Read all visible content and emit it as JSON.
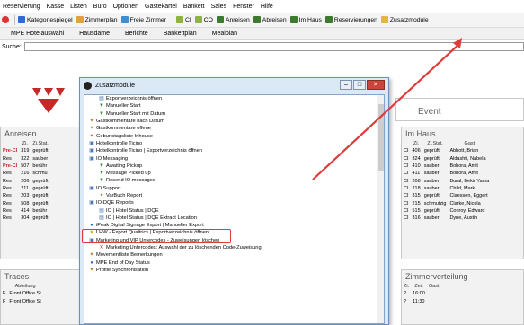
{
  "menubar": [
    "Reservierung",
    "Kasse",
    "Listen",
    "Büro",
    "Optionen",
    "Gästekartei",
    "Bankett",
    "Sales",
    "Fenster",
    "Hilfe"
  ],
  "toolbar": [
    "Kategoriespiegel",
    "Zimmerplan",
    "Freie Zimmer",
    "CI",
    "CO",
    "Anreisen",
    "Abreisen",
    "Im Haus",
    "Reservierungen",
    "Zusatzmodule"
  ],
  "nav": [
    "MPE Hotelauswahl",
    "Hausdame",
    "Berichte",
    "Bankettplan",
    "Mealplan"
  ],
  "search": {
    "label": "Suche:",
    "value": ""
  },
  "anreisen": {
    "title": "Anreisen",
    "headers": [
      "",
      "Zi.",
      "Zi.Stat."
    ],
    "rows": [
      [
        "Pre-CI",
        "319",
        "geprüft"
      ],
      [
        "Res",
        "322",
        "sauber"
      ],
      [
        "Pre-CI",
        "507",
        "berühr"
      ],
      [
        "Res",
        "216",
        "schmu"
      ],
      [
        "Res",
        "206",
        "geprüft"
      ],
      [
        "Res",
        "211",
        "geprüft"
      ],
      [
        "Res",
        "203",
        "geprüft"
      ],
      [
        "Res",
        "508",
        "geprüft"
      ],
      [
        "Res",
        "414",
        "berühr"
      ],
      [
        "Res",
        "304",
        "geprüft"
      ]
    ]
  },
  "imhaus": {
    "title": "Im Haus",
    "headers": [
      "",
      "Zi.",
      "Zi.Stat.",
      "Gast"
    ],
    "rows": [
      [
        "CI",
        "406",
        "geprüft",
        "Abbott, Brian"
      ],
      [
        "CI",
        "324",
        "geprüft",
        "Aldashti, Nabela"
      ],
      [
        "CI",
        "410",
        "sauber",
        "Bohora, Amit"
      ],
      [
        "CI",
        "411",
        "sauber",
        "Bohora, Amit"
      ],
      [
        "CI",
        "208",
        "sauber",
        "Bural, Bekir Yama"
      ],
      [
        "CI",
        "218",
        "sauber",
        "Child, Mark"
      ],
      [
        "CI",
        "315",
        "geprüft",
        "Claessen, Eggert"
      ],
      [
        "CI",
        "215",
        "schmutzig",
        "Clarke, Nicola"
      ],
      [
        "CI",
        "515",
        "geprüft",
        "Conroy, Edward"
      ],
      [
        "CI",
        "316",
        "sauber",
        "Dyne, Austin"
      ]
    ]
  },
  "event": {
    "title": "Event"
  },
  "traces": {
    "title": "Traces",
    "headers": [
      "",
      "Abteilung"
    ],
    "rows": [
      [
        "F",
        "Front Office St"
      ],
      [
        "F",
        "Front Office St"
      ]
    ]
  },
  "zimmerverteilung": {
    "title": "Zimmerverteilung",
    "headers": [
      "Zi.",
      "Zeit",
      "Gast"
    ],
    "rows": [
      [
        "?",
        "16:00"
      ],
      [
        "?",
        "11:30"
      ]
    ]
  },
  "dialog": {
    "title": "Zusatzmodule",
    "items": [
      {
        "indent": 2,
        "icon": "doc-icon",
        "label": "Exportverzeichnis öffnen"
      },
      {
        "indent": 2,
        "icon": "flag-icon",
        "label": "Manueller Start"
      },
      {
        "indent": 2,
        "icon": "flag-icon",
        "label": "Manueller Start mit Datum"
      },
      {
        "indent": 1,
        "icon": "gear-icon",
        "label": "Gastkommentare nach Datum"
      },
      {
        "indent": 1,
        "icon": "gear-icon",
        "label": "Gastkommentare offene"
      },
      {
        "indent": 1,
        "icon": "gear-icon",
        "label": "Geburtstagsliste Inhouse"
      },
      {
        "indent": 1,
        "icon": "folder-icon",
        "label": "Hotelkontrolle Ticino"
      },
      {
        "indent": 1,
        "icon": "folder-icon",
        "label": "Hotelkontrolle Ticino | Exportverzeichnis öffnen"
      },
      {
        "indent": 1,
        "icon": "folder-icon",
        "label": "IO Messaging"
      },
      {
        "indent": 2,
        "icon": "flag-icon",
        "label": "Awaiting Pickup"
      },
      {
        "indent": 2,
        "icon": "flag-icon",
        "label": "Message Picked up"
      },
      {
        "indent": 2,
        "icon": "flag-icon",
        "label": "Resend IO messages"
      },
      {
        "indent": 1,
        "icon": "folder-icon",
        "label": "IO Support"
      },
      {
        "indent": 2,
        "icon": "gear-icon",
        "label": "VarBuch Report"
      },
      {
        "indent": 1,
        "icon": "folder-icon",
        "label": "IO-DQE Reports"
      },
      {
        "indent": 2,
        "icon": "doc-icon",
        "label": "IO | Hotel Status | DQE"
      },
      {
        "indent": 2,
        "icon": "doc-icon",
        "label": "IO | Hotel Status | DQE  Extract Location"
      },
      {
        "indent": 1,
        "icon": "info-icon",
        "label": "iPeak Digital Signage Export | Manueller Export"
      },
      {
        "indent": 1,
        "icon": "star-icon",
        "label": "LHW - Export Qualtrics | Exportverzeichnis öffnen"
      },
      {
        "indent": 1,
        "icon": "folder-icon",
        "label": "Marketing und VIP Untercodes - Zuweisungen löschen"
      },
      {
        "indent": 2,
        "icon": "x-icon",
        "label": "Marketing Untercodes: Auswahl der zu löschenden Code-Zuweisung"
      },
      {
        "indent": 1,
        "icon": "gear-icon",
        "label": "Movementliste Bemerkungen"
      },
      {
        "indent": 1,
        "icon": "info-icon",
        "label": "MPE End of Day Status"
      },
      {
        "indent": 1,
        "icon": "gear-icon",
        "label": "Profile Synchronisation"
      }
    ]
  },
  "colors": {
    "accent": "#e03a3a",
    "dialog_bg": "#dbe8f6",
    "panel_bg": "#f2f2f2",
    "logo": "#c62828"
  }
}
